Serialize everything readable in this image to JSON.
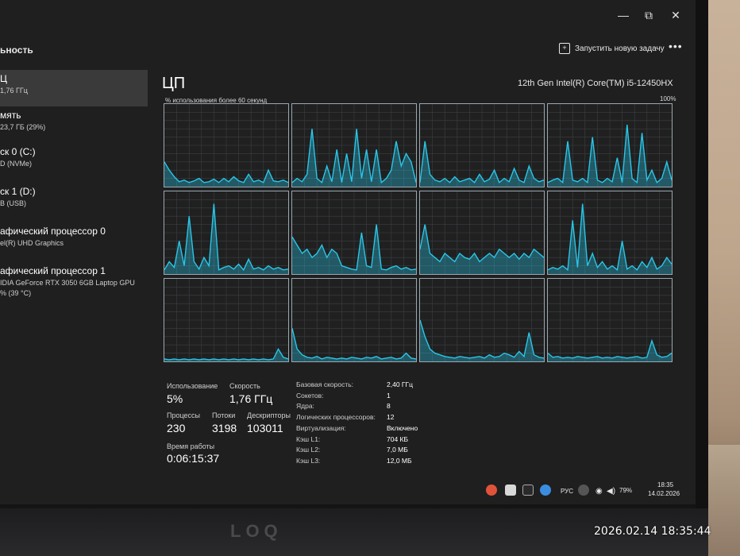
{
  "app": {
    "page_heading": "ьность"
  },
  "toolbar": {
    "new_task_label": "Запустить новую задачу",
    "more_label": "•••"
  },
  "window": {
    "minimize": "—",
    "restore": "⧉",
    "close": "✕"
  },
  "sidebar": {
    "items": [
      {
        "title": "Ц",
        "sub": "1,76 ГГц"
      },
      {
        "title": "мять",
        "sub": "23,7 ГБ (29%)"
      },
      {
        "title": "ск 0 (C:)",
        "sub": "D (NVMe)"
      },
      {
        "title": "ск 1 (D:)",
        "sub": "B (USB)"
      },
      {
        "title": "афический процессор 0",
        "sub": "el(R) UHD Graphics"
      },
      {
        "title": "афический процессор 1",
        "sub": "IDIA GeForce RTX 3050 6GB Laptop GPU",
        "sub2": "% (39 °C)"
      }
    ]
  },
  "cpu": {
    "title": "ЦП",
    "model": "12th Gen Intel(R) Core(TM) i5-12450HX",
    "graph_label": "% использования более 60 секунд",
    "graph_max": "100%",
    "graph_color": "#29c6e8",
    "cores": [
      [
        0.3,
        0.2,
        0.12,
        0.06,
        0.08,
        0.05,
        0.07,
        0.1,
        0.05,
        0.06,
        0.09,
        0.05,
        0.1,
        0.06,
        0.12,
        0.07,
        0.05,
        0.15,
        0.06,
        0.08,
        0.05,
        0.2,
        0.07,
        0.06,
        0.08,
        0.05
      ],
      [
        0.05,
        0.1,
        0.06,
        0.15,
        0.7,
        0.1,
        0.05,
        0.25,
        0.06,
        0.45,
        0.05,
        0.4,
        0.06,
        0.7,
        0.1,
        0.45,
        0.06,
        0.45,
        0.05,
        0.1,
        0.2,
        0.55,
        0.25,
        0.4,
        0.3,
        0.05
      ],
      [
        0.05,
        0.55,
        0.15,
        0.08,
        0.06,
        0.1,
        0.05,
        0.12,
        0.06,
        0.08,
        0.1,
        0.05,
        0.15,
        0.06,
        0.09,
        0.2,
        0.05,
        0.1,
        0.06,
        0.22,
        0.08,
        0.05,
        0.25,
        0.1,
        0.06,
        0.08
      ],
      [
        0.05,
        0.08,
        0.1,
        0.05,
        0.55,
        0.08,
        0.06,
        0.1,
        0.05,
        0.6,
        0.08,
        0.05,
        0.1,
        0.06,
        0.35,
        0.05,
        0.75,
        0.1,
        0.05,
        0.65,
        0.08,
        0.2,
        0.05,
        0.1,
        0.3,
        0.08
      ],
      [
        0.05,
        0.15,
        0.08,
        0.4,
        0.1,
        0.7,
        0.15,
        0.06,
        0.2,
        0.1,
        0.85,
        0.05,
        0.08,
        0.1,
        0.06,
        0.12,
        0.05,
        0.18,
        0.06,
        0.08,
        0.05,
        0.1,
        0.06,
        0.08,
        0.05,
        0.06
      ],
      [
        0.45,
        0.35,
        0.25,
        0.3,
        0.2,
        0.25,
        0.35,
        0.2,
        0.3,
        0.25,
        0.1,
        0.08,
        0.06,
        0.05,
        0.5,
        0.1,
        0.08,
        0.6,
        0.06,
        0.05,
        0.08,
        0.1,
        0.06,
        0.08,
        0.05,
        0.06
      ],
      [
        0.3,
        0.6,
        0.25,
        0.2,
        0.15,
        0.25,
        0.2,
        0.15,
        0.25,
        0.2,
        0.18,
        0.25,
        0.15,
        0.2,
        0.25,
        0.2,
        0.3,
        0.25,
        0.2,
        0.25,
        0.18,
        0.25,
        0.2,
        0.3,
        0.25,
        0.2
      ],
      [
        0.05,
        0.08,
        0.06,
        0.1,
        0.05,
        0.65,
        0.08,
        0.85,
        0.1,
        0.25,
        0.08,
        0.15,
        0.06,
        0.1,
        0.05,
        0.4,
        0.06,
        0.1,
        0.05,
        0.15,
        0.08,
        0.2,
        0.06,
        0.1,
        0.2,
        0.12
      ],
      [
        0.03,
        0.02,
        0.03,
        0.02,
        0.03,
        0.02,
        0.03,
        0.02,
        0.03,
        0.02,
        0.03,
        0.02,
        0.03,
        0.02,
        0.03,
        0.02,
        0.03,
        0.02,
        0.03,
        0.02,
        0.03,
        0.02,
        0.03,
        0.15,
        0.05,
        0.03
      ],
      [
        0.4,
        0.15,
        0.08,
        0.05,
        0.04,
        0.06,
        0.03,
        0.05,
        0.04,
        0.03,
        0.04,
        0.03,
        0.05,
        0.04,
        0.03,
        0.05,
        0.04,
        0.06,
        0.03,
        0.04,
        0.05,
        0.03,
        0.04,
        0.1,
        0.04,
        0.03
      ],
      [
        0.5,
        0.3,
        0.15,
        0.1,
        0.08,
        0.06,
        0.05,
        0.04,
        0.06,
        0.05,
        0.04,
        0.05,
        0.06,
        0.04,
        0.08,
        0.05,
        0.06,
        0.1,
        0.08,
        0.05,
        0.12,
        0.06,
        0.35,
        0.08,
        0.05,
        0.04
      ],
      [
        0.1,
        0.05,
        0.06,
        0.04,
        0.05,
        0.04,
        0.06,
        0.05,
        0.04,
        0.05,
        0.06,
        0.04,
        0.05,
        0.04,
        0.06,
        0.05,
        0.04,
        0.05,
        0.06,
        0.04,
        0.05,
        0.25,
        0.08,
        0.05,
        0.06,
        0.1
      ]
    ]
  },
  "stats": {
    "utilization_label": "Использование",
    "utilization_value": "5%",
    "speed_label": "Скорость",
    "speed_value": "1,76 ГГц",
    "processes_label": "Процессы",
    "processes_value": "230",
    "threads_label": "Потоки",
    "threads_value": "3198",
    "handles_label": "Дескрипторы",
    "handles_value": "103011",
    "uptime_label": "Время работы",
    "uptime_value": "0:06:15:37"
  },
  "details": [
    {
      "label": "Базовая скорость:",
      "value": "2,40 ГГц"
    },
    {
      "label": "Сокетов:",
      "value": "1"
    },
    {
      "label": "Ядра:",
      "value": "8"
    },
    {
      "label": "Логических процессоров:",
      "value": "12"
    },
    {
      "label": "Виртуализация:",
      "value": "Включено"
    },
    {
      "label": "Кэш L1:",
      "value": "704 КБ"
    },
    {
      "label": "Кэш L2:",
      "value": "7,0 МБ"
    },
    {
      "label": "Кэш L3:",
      "value": "12,0 МБ"
    }
  ],
  "tray": {
    "lang": "РУС",
    "battery": "79%",
    "time": "18:35",
    "date": "14.02.2026"
  },
  "brand": "LOQ",
  "photo_timestamp": "2026.02.14 18:35:44"
}
